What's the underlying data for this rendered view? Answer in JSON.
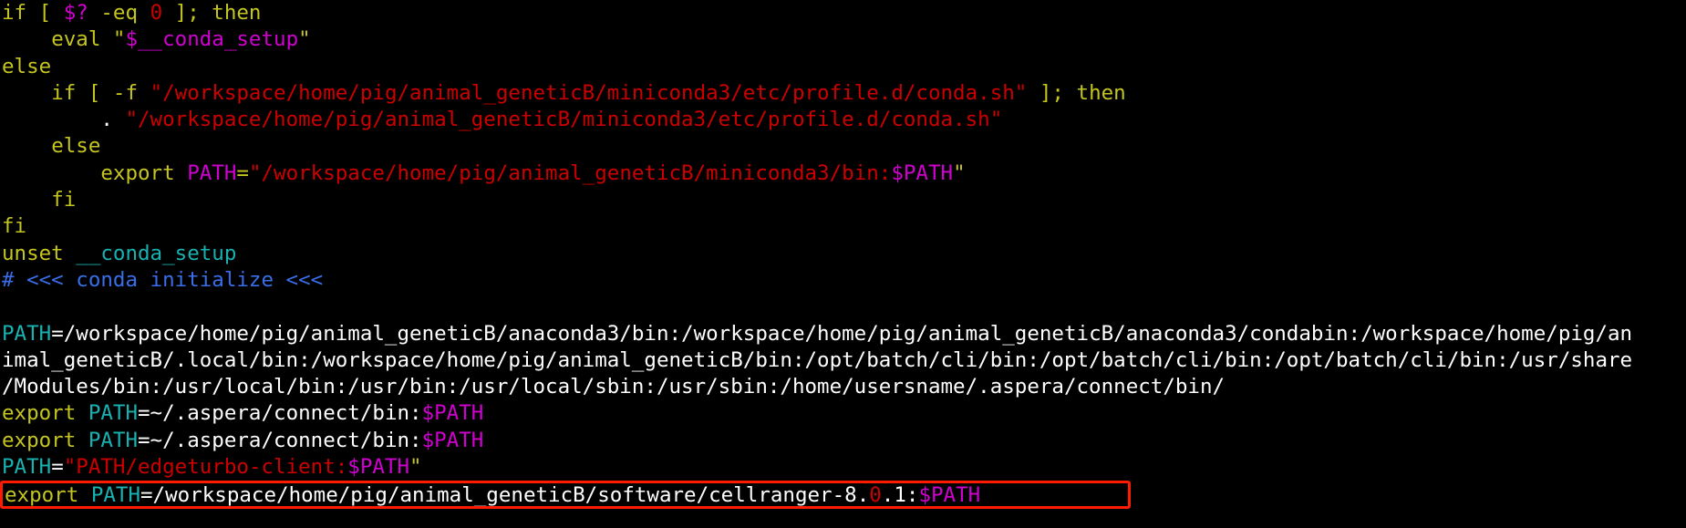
{
  "terminal": {
    "background_color": "#000000",
    "default_text_color": "#ffffff",
    "highlight_border_color": "#ff1a00",
    "colors": {
      "keyword_yellow": "#c5c520",
      "string_red": "#cc0000",
      "variable_magenta": "#d000d0",
      "identifier_cyan": "#18b2b2",
      "comment_blue": "#3a6ee8",
      "plain_white": "#ffffff"
    }
  },
  "lines": {
    "l1": {
      "t1": "if",
      "t2": " [ ",
      "t3": "$?",
      "t4": " -eq ",
      "t5": "0",
      "t6": " ]; ",
      "t7": "then"
    },
    "l2": {
      "indent": "    ",
      "t1": "eval",
      "t2": " \"",
      "t3": "$__conda_setup",
      "t4": "\""
    },
    "l3": {
      "t1": "else"
    },
    "l4": {
      "indent": "    ",
      "t1": "if",
      "t2": " [ -f ",
      "t3": "\"/workspace/home/pig/animal_geneticB/miniconda3/etc/profile.d/conda.sh\"",
      "t4": " ]; ",
      "t5": "then"
    },
    "l5": {
      "indent": "        ",
      "t1": ".",
      "t2": " ",
      "t3": "\"/workspace/home/pig/animal_geneticB/miniconda3/etc/profile.d/conda.sh\""
    },
    "l6": {
      "indent": "    ",
      "t1": "else"
    },
    "l7": {
      "indent": "        ",
      "t1": "export",
      "t2": " ",
      "t3": "PATH",
      "t4": "=",
      "t5": "\"/workspace/home/pig/animal_geneticB/miniconda3/bin:",
      "t6": "$PATH",
      "t7": "\""
    },
    "l8": {
      "indent": "    ",
      "t1": "fi"
    },
    "l9": {
      "t1": "fi"
    },
    "l10": {
      "t1": "unset",
      "t2": " ",
      "t3": "__conda_setup"
    },
    "l11": {
      "t1": "# <<< conda initialize <<<"
    },
    "l12": {
      "t1": ""
    },
    "l13": {
      "t1": "PATH",
      "t2": "=/workspace/home/pig/animal_geneticB/anaconda3/bin:/workspace/home/pig/animal_geneticB/anaconda3/condabin:/workspace/home/pig/an"
    },
    "l14": {
      "t1": "imal_geneticB/.local/bin:/workspace/home/pig/animal_geneticB/bin:/opt/batch/cli/bin:/opt/batch/cli/bin:/opt/batch/cli/bin:/usr/share"
    },
    "l15": {
      "t1": "/Modules/bin:/usr/local/bin:/usr/bin:/usr/local/sbin:/usr/sbin:/home/usersname/.aspera/connect/bin/"
    },
    "l16": {
      "t1": "export",
      "t2": " ",
      "t3": "PATH",
      "t4": "=~/.aspera/connect/bin:",
      "t5": "$PATH"
    },
    "l17": {
      "t1": "export",
      "t2": " ",
      "t3": "PATH",
      "t4": "=~/.aspera/connect/bin:",
      "t5": "$PATH"
    },
    "l18": {
      "t1": "PATH",
      "t2": "=",
      "t3": "\"PATH/edgeturbo-client:",
      "t4": "$PATH",
      "t5": "\""
    },
    "l19": {
      "t1": "export",
      "t2": " ",
      "t3": "PATH",
      "t4": "=/workspace/home/pig/animal_geneticB/software/cellranger-8.",
      "t5": "0",
      "t6": ".1:",
      "t7": "$PATH"
    }
  }
}
